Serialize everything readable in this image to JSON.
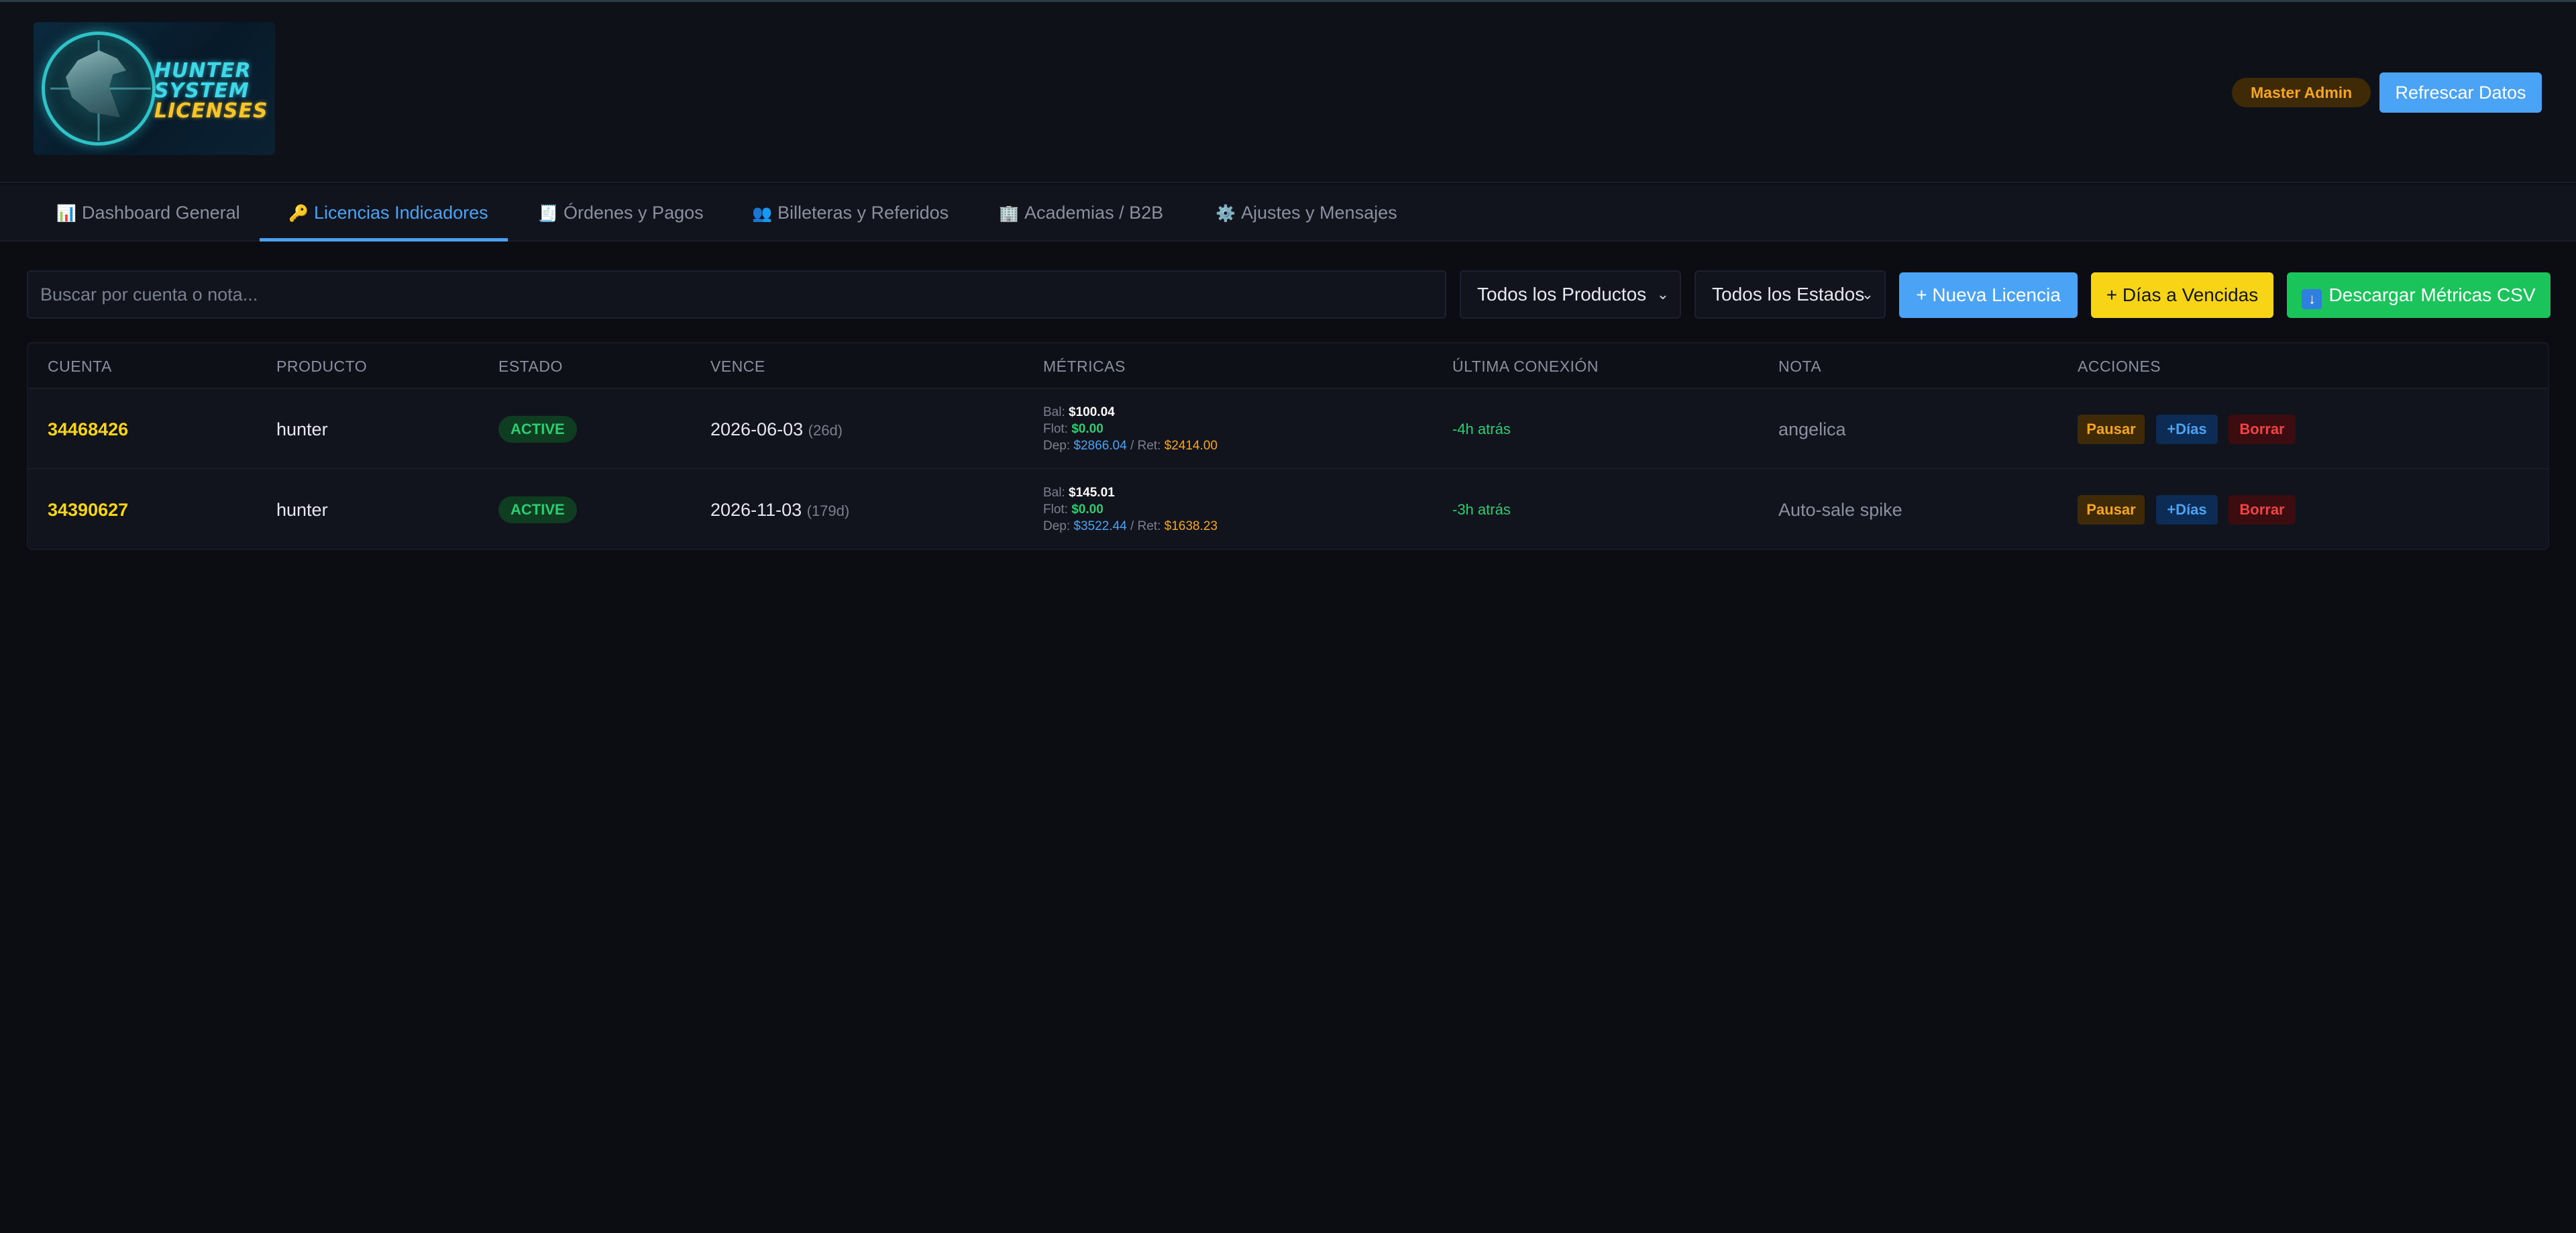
{
  "app": {
    "logo_text": [
      "HUNTER",
      "SYSTEM",
      "LICENSES"
    ],
    "role_badge": "Master Admin",
    "refresh_label": "Refrescar Datos"
  },
  "tabs": [
    {
      "icon": "📊",
      "label": "Dashboard General",
      "active": false
    },
    {
      "icon": "🔑",
      "label": "Licencias Indicadores",
      "active": true
    },
    {
      "icon": "🧾",
      "label": "Órdenes y Pagos",
      "active": false
    },
    {
      "icon": "👥",
      "label": "Billeteras y Referidos",
      "active": false
    },
    {
      "icon": "🏢",
      "label": "Academias / B2B",
      "active": false
    },
    {
      "icon": "⚙️",
      "label": "Ajustes y Mensajes",
      "active": false
    }
  ],
  "toolbar": {
    "search_placeholder": "Buscar por cuenta o nota...",
    "search_value": "",
    "product_filter": "Todos los Productos",
    "status_filter": "Todos los Estados",
    "new_license_label": "+ Nueva Licencia",
    "days_expired_label": "+ Días a Vencidas",
    "download_csv_label": "Descargar Métricas CSV"
  },
  "table": {
    "headers": [
      "CUENTA",
      "PRODUCTO",
      "ESTADO",
      "VENCE",
      "MÉTRICAS",
      "ÚLTIMA CONEXIÓN",
      "NOTA",
      "ACCIONES"
    ],
    "rows": [
      {
        "account": "34468426",
        "product": "hunter",
        "status": "ACTIVE",
        "expires": "2026-06-03",
        "days_left": "(26d)",
        "metrics": {
          "bal_label": "Bal:",
          "bal": "$100.04",
          "flot_label": "Flot:",
          "flot": "$0.00",
          "dep_label": "Dep:",
          "dep": "$2866.04",
          "sep": " / ",
          "ret_label": "Ret:",
          "ret": "$2414.00"
        },
        "last_connection": "-4h atrás",
        "note": "angelica",
        "actions": {
          "pause": "Pausar",
          "add_days": "+Días",
          "delete": "Borrar"
        }
      },
      {
        "account": "34390627",
        "product": "hunter",
        "status": "ACTIVE",
        "expires": "2026-11-03",
        "days_left": "(179d)",
        "metrics": {
          "bal_label": "Bal:",
          "bal": "$145.01",
          "flot_label": "Flot:",
          "flot": "$0.00",
          "dep_label": "Dep:",
          "dep": "$3522.44",
          "sep": " / ",
          "ret_label": "Ret:",
          "ret": "$1638.23"
        },
        "last_connection": "-3h atrás",
        "note": "Auto-sale spike",
        "actions": {
          "pause": "Pausar",
          "add_days": "+Días",
          "delete": "Borrar"
        }
      }
    ]
  },
  "colors": {
    "accent_blue": "#4aa3f5",
    "accent_yellow": "#f8d417",
    "accent_green": "#1bc45b",
    "status_active": "#2ecc71",
    "danger": "#ef4444",
    "warning": "#f5a524"
  }
}
